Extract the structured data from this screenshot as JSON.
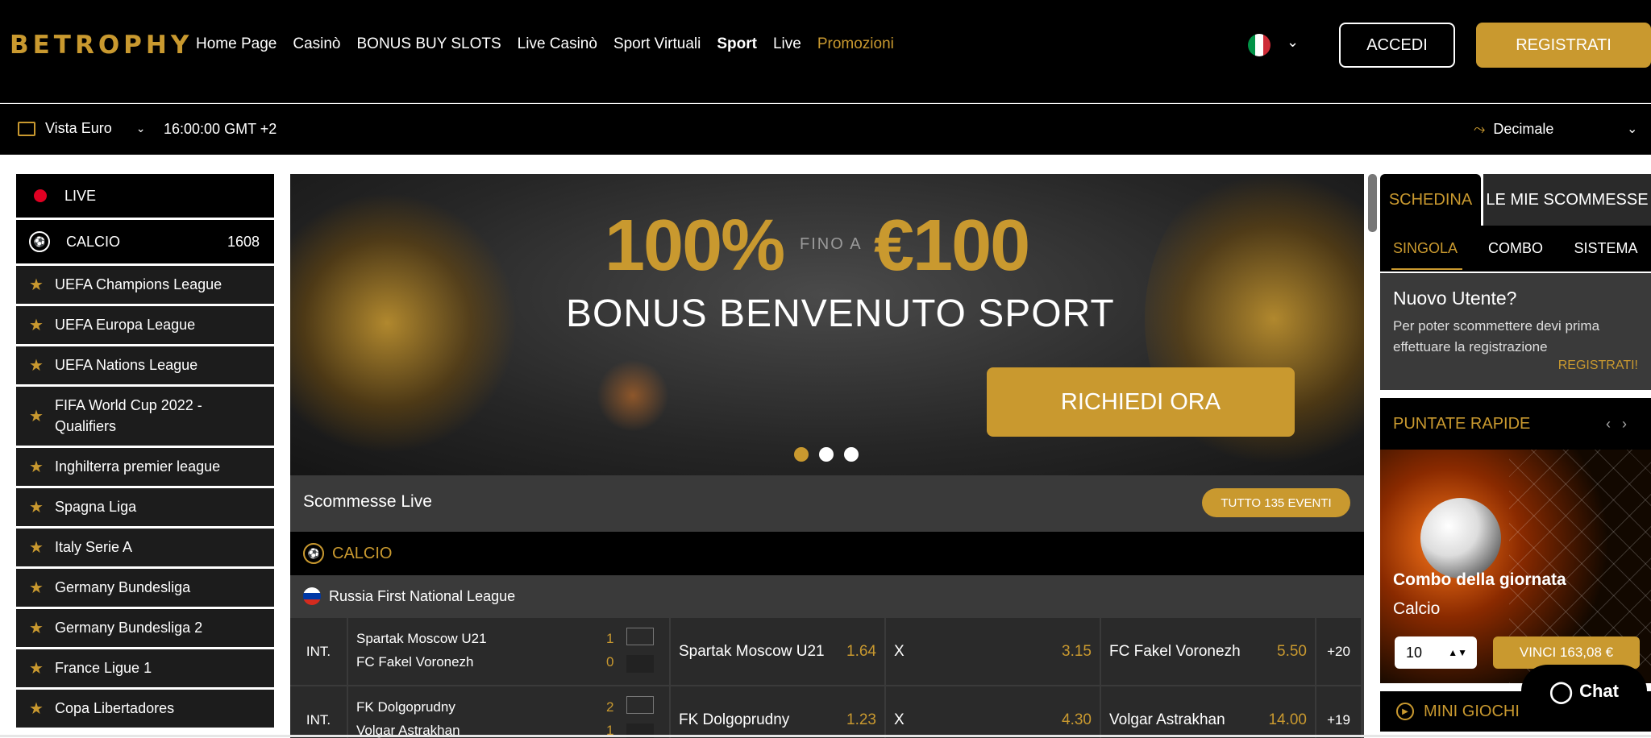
{
  "header": {
    "logo": "BETROPHY",
    "nav": [
      "Home Page",
      "Casinò",
      "BONUS BUY SLOTS",
      "Live Casinò",
      "Sport Virtuali",
      "Sport",
      "Live",
      "Promozioni"
    ],
    "login": "ACCEDI",
    "register": "REGISTRATI",
    "chevron": "⌄"
  },
  "subbar": {
    "view": "Vista Euro",
    "time": "16:00:00 GMT +2",
    "odds_format": "Decimale",
    "chevron": "⌄",
    "trend_icon": "⤳"
  },
  "sidebar": {
    "live": "LIVE",
    "calcio": "CALCIO",
    "calcio_count": "1608",
    "leagues": [
      "UEFA Champions League",
      "UEFA Europa League",
      "UEFA Nations League",
      "FIFA World Cup 2022 - Qualifiers",
      "Inghilterra premier league",
      "Spagna Liga",
      "Italy Serie A",
      "Germany Bundesliga",
      "Germany Bundesliga 2",
      "France Ligue 1",
      "Copa Libertadores"
    ],
    "star": "★"
  },
  "banner": {
    "percent": "100%",
    "fino": "FINO A",
    "amount": "€100",
    "title": "BONUS BENVENUTO SPORT",
    "cta": "RICHIEDI ORA",
    "active_slide": 1,
    "slides": 3
  },
  "live_section": {
    "title": "Scommesse Live",
    "all_events": "TUTTO 135 EVENTI",
    "sport": "CALCIO",
    "league": "Russia First National League",
    "matches": [
      {
        "status": "INT.",
        "home": "Spartak Moscow U21",
        "away": "FC Fakel Voronezh",
        "home_score": "1",
        "away_score": "0",
        "home_odd_label": "Spartak Moscow U21",
        "home_odd": "1.64",
        "draw_label": "X",
        "draw_odd": "3.15",
        "away_odd_label": "FC Fakel Voronezh",
        "away_odd": "5.50",
        "more": "+20"
      },
      {
        "status": "INT.",
        "home": "FK Dolgoprudny",
        "away": "Volgar Astrakhan",
        "home_score": "2",
        "away_score": "1",
        "home_odd_label": "FK Dolgoprudny",
        "home_odd": "1.23",
        "draw_label": "X",
        "draw_odd": "4.30",
        "away_odd_label": "Volgar Astrakhan",
        "away_odd": "14.00",
        "more": "+19"
      }
    ]
  },
  "betslip": {
    "tab_schedina": "SCHEDINA",
    "tab_mie": "LE MIE SCOMMESSE",
    "sub_tabs": [
      "SINGOLA",
      "COMBO",
      "SISTEMA"
    ],
    "new_user_title": "Nuovo Utente?",
    "new_user_text": "Per poter scommettere devi prima effettuare la registrazione",
    "new_user_link": "REGISTRATI!",
    "quick_bets": "PUNTATE RAPIDE",
    "quick_prev": "‹",
    "quick_next": "›",
    "combo_title": "Combo della giornata",
    "combo_sport": "Calcio",
    "stake": "10",
    "win": "VINCI 163,08 €",
    "mini_games": "MINI GIOCHI"
  },
  "chat": {
    "label": "Chat"
  },
  "colors": {
    "accent": "#c9992f",
    "live_dot": "#e00022"
  }
}
